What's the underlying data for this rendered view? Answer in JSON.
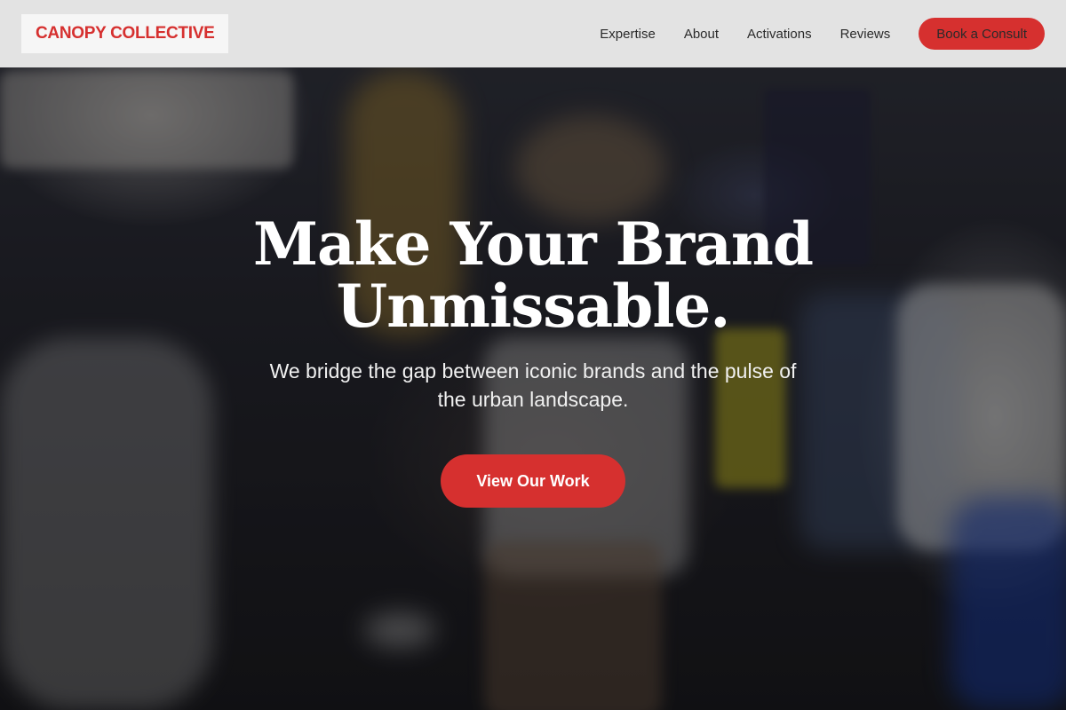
{
  "brand": {
    "name": "CANOPY COLLECTIVE",
    "accent": "#d6302f"
  },
  "nav": {
    "items": [
      {
        "label": "Expertise"
      },
      {
        "label": "About"
      },
      {
        "label": "Activations"
      },
      {
        "label": "Reviews"
      }
    ],
    "cta_label": "Book a Consult"
  },
  "hero": {
    "headline_line1": "Make Your Brand",
    "headline_line2": "Unmissable.",
    "subhead_line1": "We bridge the gap between iconic brands and the pulse of",
    "subhead_line2": "the urban landscape.",
    "cta_label": "View Our Work",
    "background_icon": "expo-crowd-photo"
  }
}
